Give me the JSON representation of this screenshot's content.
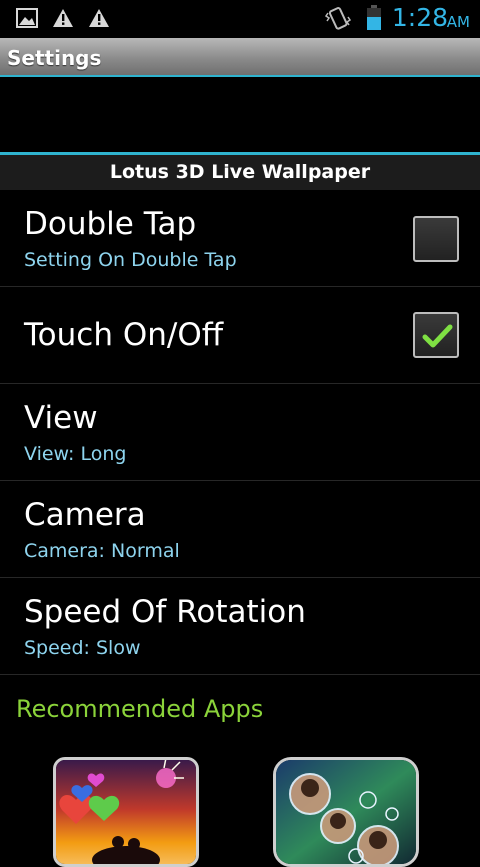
{
  "status_bar": {
    "time": "1:28",
    "ampm": "AM",
    "icons": [
      "image-icon",
      "warning-icon",
      "warning-icon",
      "vibrate-icon",
      "battery-icon"
    ]
  },
  "title_bar": {
    "title": "Settings"
  },
  "category": {
    "label": "Lotus 3D Live Wallpaper"
  },
  "preferences": [
    {
      "title": "Double Tap",
      "summary": "Setting On Double Tap",
      "checkbox": true,
      "checked": false
    },
    {
      "title": "Touch On/Off",
      "summary": "",
      "checkbox": true,
      "checked": true
    },
    {
      "title": "View",
      "summary": "View: Long",
      "checkbox": false
    },
    {
      "title": "Camera",
      "summary": "Camera: Normal",
      "checkbox": false
    },
    {
      "title": "Speed Of Rotation",
      "summary": "Speed: Slow",
      "checkbox": false
    }
  ],
  "recommended": {
    "label": "Recommended Apps",
    "apps": [
      {
        "icon": "hearts-sunset-app-icon"
      },
      {
        "icon": "bubbles-portrait-app-icon"
      }
    ]
  },
  "colors": {
    "accent_blue": "#33b5e5",
    "summary_text": "#8ed4ee",
    "recommended_green": "#8bd33a",
    "check_green": "#7fe043"
  }
}
